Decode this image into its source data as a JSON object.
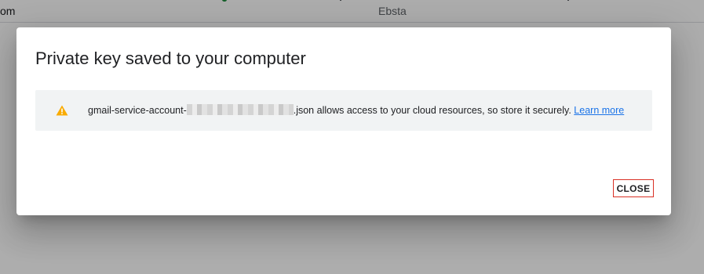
{
  "background": {
    "left_text": "om",
    "center_text": "Ebsta"
  },
  "dialog": {
    "title": "Private key saved to your computer",
    "notice": {
      "icon": "warning-icon",
      "icon_color": "#f9ab00",
      "filename_prefix": "gmail-service-account-",
      "filename_suffix": ".json",
      "message": " allows access to your cloud resources, so store it securely. ",
      "link_label": "Learn more"
    },
    "close_label": "CLOSE"
  },
  "colors": {
    "link": "#1a73e8",
    "close_border": "#d93025",
    "notice_bg": "#f1f3f4"
  }
}
